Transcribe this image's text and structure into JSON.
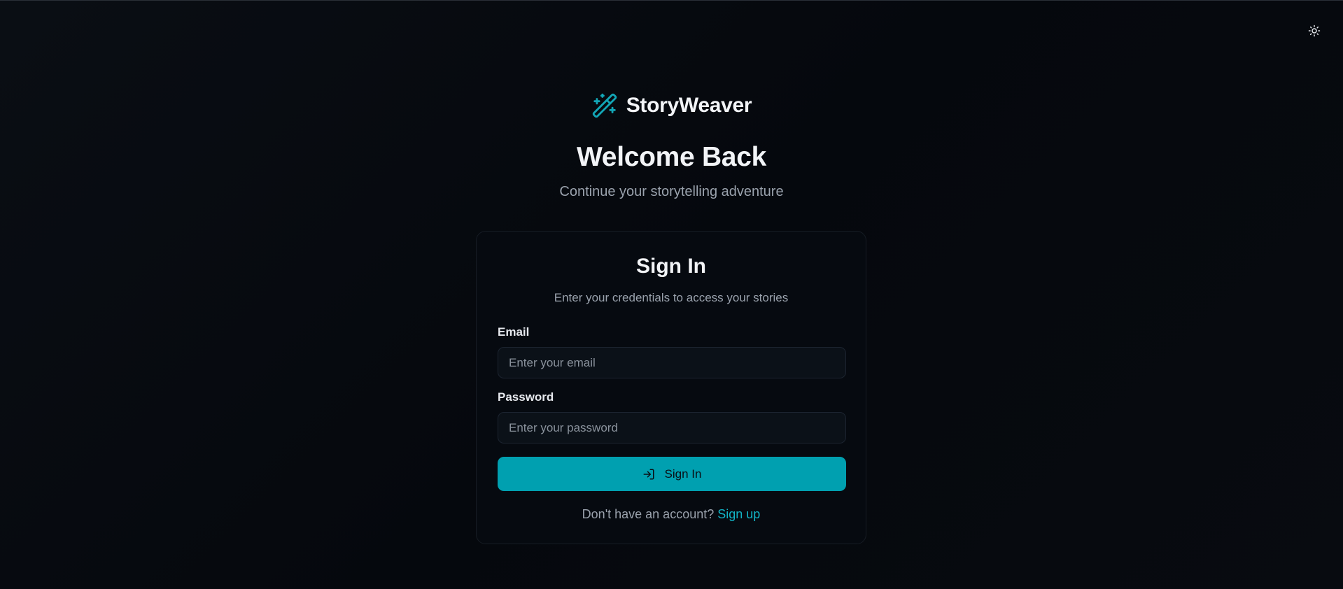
{
  "app": {
    "name": "StoryWeaver",
    "logo_icon": "magic-wand-icon",
    "accent_color": "#00a0b0"
  },
  "header": {
    "theme_toggle_icon": "sun-icon"
  },
  "hero": {
    "title": "Welcome Back",
    "subtitle": "Continue your storytelling adventure"
  },
  "card": {
    "title": "Sign In",
    "subtitle": "Enter your credentials to access your stories",
    "email": {
      "label": "Email",
      "placeholder": "Enter your email",
      "value": ""
    },
    "password": {
      "label": "Password",
      "placeholder": "Enter your password",
      "value": ""
    },
    "submit": {
      "label": "Sign In",
      "icon": "log-in-icon"
    },
    "signup": {
      "prompt": "Don't have an account?",
      "link_label": "Sign up"
    }
  }
}
